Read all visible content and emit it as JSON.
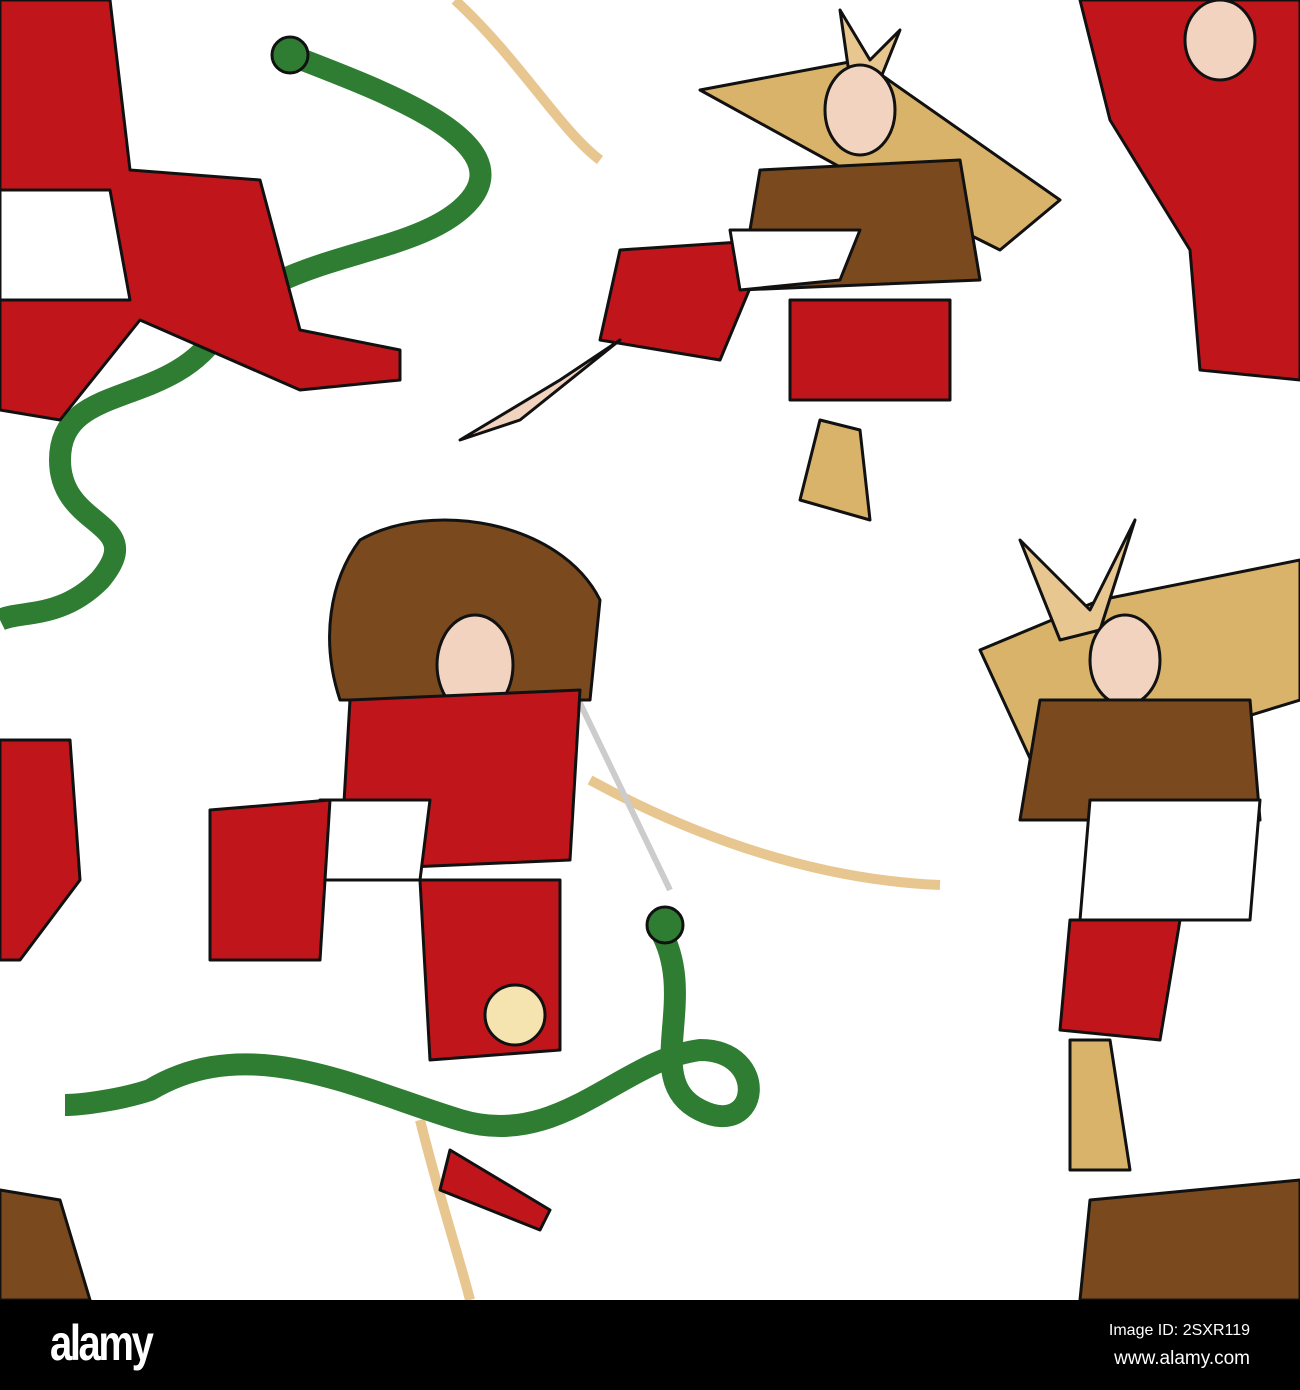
{
  "footer": {
    "logo": "alamy",
    "image_id": "Image ID: 2SXR119",
    "site": "www.alamy.com"
  },
  "colors": {
    "red": "#c0161b",
    "gold": "#d9b36a",
    "brown": "#7a4a1e",
    "green": "#2e7d32",
    "skin": "#f1d3c0"
  }
}
